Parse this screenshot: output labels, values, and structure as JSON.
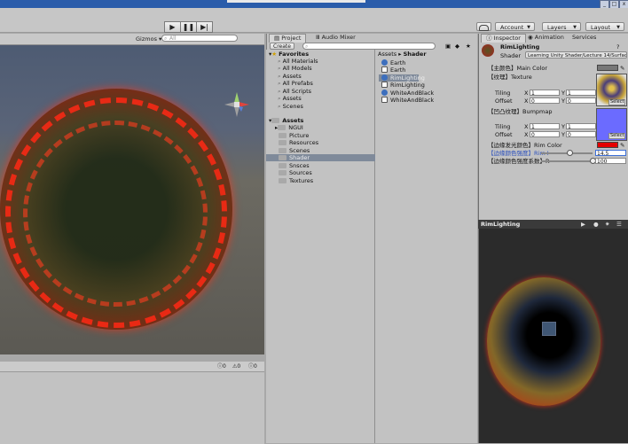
{
  "toolbar": {
    "play_icon": "▶",
    "pause_icon": "❚❚",
    "step_icon": "▶|",
    "cloud_icon": "cloud-icon",
    "account_label": "Account",
    "layers_label": "Layers",
    "layout_label": "Layout"
  },
  "scene": {
    "gizmos_label": "Gizmos ▾",
    "search_placeholder": "All",
    "persp_label": "",
    "gizmo_icon": "axis-gizmo-icon"
  },
  "console": {
    "info_count": "0",
    "warn_count": "0",
    "error_count": "0"
  },
  "project": {
    "tab_project": "Project",
    "tab_audio": "Audio Mixer",
    "create_label": "Create ▾",
    "breadcrumb_root": "Assets",
    "breadcrumb_sep": "▸",
    "breadcrumb_leaf": "Shader",
    "favorites": {
      "header": "Favorites",
      "items": [
        "All Materials",
        "All Models",
        "Assets",
        "All Prefabs",
        "All Scripts",
        "Assets",
        "Scenes"
      ]
    },
    "assets": {
      "header": "Assets",
      "items": [
        "NGUI",
        "Picture",
        "Resources",
        "Scenes",
        "Shader",
        "Snsces",
        "Sources",
        "Textures"
      ],
      "selected": "Shader"
    },
    "files": [
      {
        "name": "Earth",
        "type": "material"
      },
      {
        "name": "Earth",
        "type": "shader"
      },
      {
        "name": "RimLighting",
        "type": "material",
        "selected": true
      },
      {
        "name": "RimLighting",
        "type": "shader"
      },
      {
        "name": "WhiteAndBlack",
        "type": "material"
      },
      {
        "name": "WhiteAndBlack",
        "type": "shader"
      }
    ]
  },
  "inspector": {
    "tab_inspector": "Inspector",
    "tab_animation": "Animation",
    "tab_services": "Services",
    "material_name": "RimLighting",
    "shader_label": "Shader",
    "shader_value": "Learning Unity Shader/Lecture 14/Surfac",
    "main_color_label": "【主颜色】Main Color",
    "texture_label": "【纹理】Texture",
    "tiling_label": "Tiling",
    "offset_label": "Offset",
    "x_label": "X",
    "y_label": "Y",
    "tex_tiling_x": "1",
    "tex_tiling_y": "1",
    "tex_offset_x": "0",
    "tex_offset_y": "0",
    "bumpmap_label": "【凹凸纹理】Bumpmap",
    "bump_tiling_x": "1",
    "bump_tiling_y": "1",
    "bump_offset_x": "0",
    "bump_offset_y": "0",
    "select_label": "Select",
    "rim_color_label": "【边缘发光颜色】Rim Color",
    "rim_power_label": "【边缘颜色强度】Rim I",
    "rim_power_value": "14.5",
    "rim_power_fraction": 0.55,
    "rim_amount_label": "【边缘颜色强度系数】R",
    "rim_amount_value": "100",
    "rim_amount_fraction": 1.0,
    "colors": {
      "main_color": "#777777",
      "rim_color": "#e40000",
      "bumpmap_swatch": "#6b6bff"
    }
  },
  "preview": {
    "title": "RimLighting"
  }
}
